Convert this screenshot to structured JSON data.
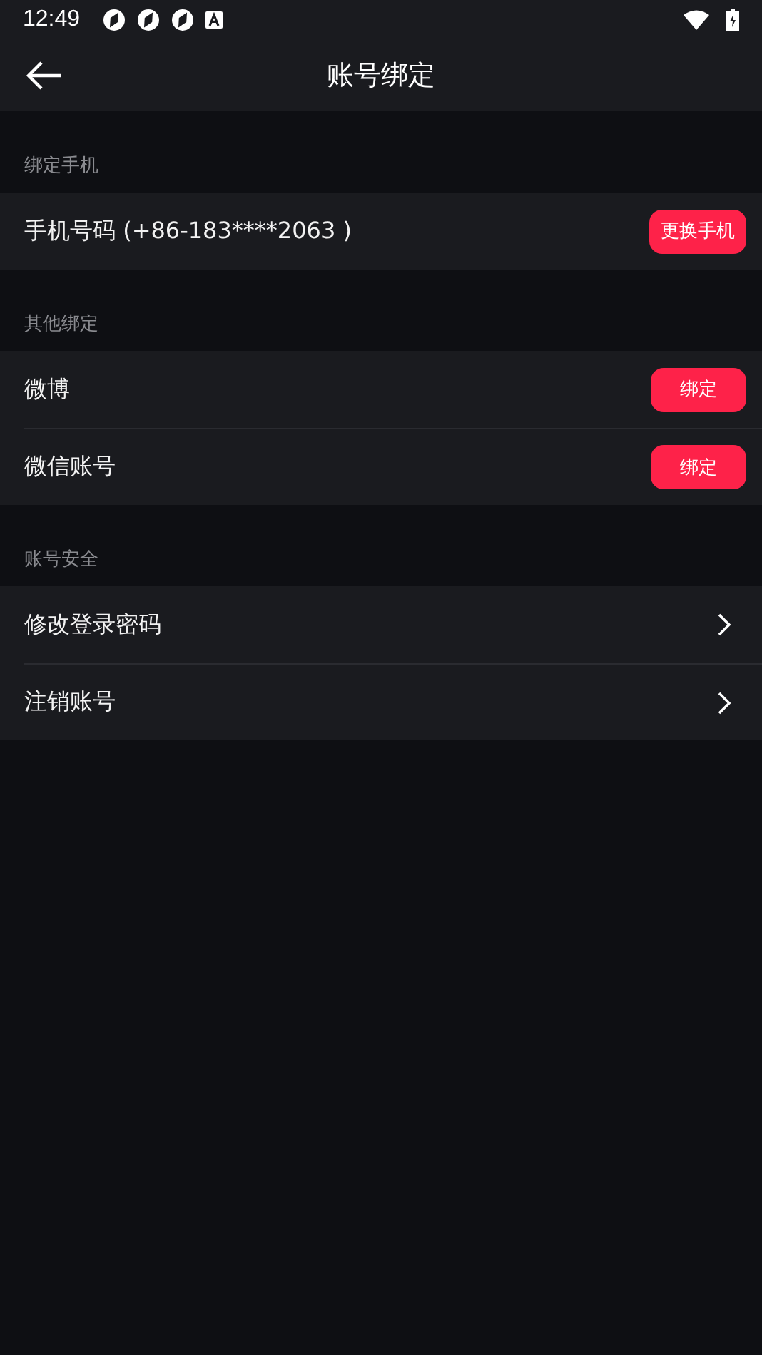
{
  "status_bar": {
    "time": "12:49"
  },
  "app_bar": {
    "title": "账号绑定"
  },
  "sections": [
    {
      "header": "绑定手机",
      "rows": [
        {
          "kind": "button",
          "label": "手机号码 (+86-183****2063 )",
          "action": "更换手机"
        }
      ]
    },
    {
      "header": "其他绑定",
      "rows": [
        {
          "kind": "button",
          "label": "微博",
          "action": "绑定"
        },
        {
          "kind": "button",
          "label": "微信账号",
          "action": "绑定"
        }
      ]
    },
    {
      "header": "账号安全",
      "rows": [
        {
          "kind": "link",
          "label": "修改登录密码"
        },
        {
          "kind": "link",
          "label": "注销账号"
        }
      ]
    }
  ]
}
